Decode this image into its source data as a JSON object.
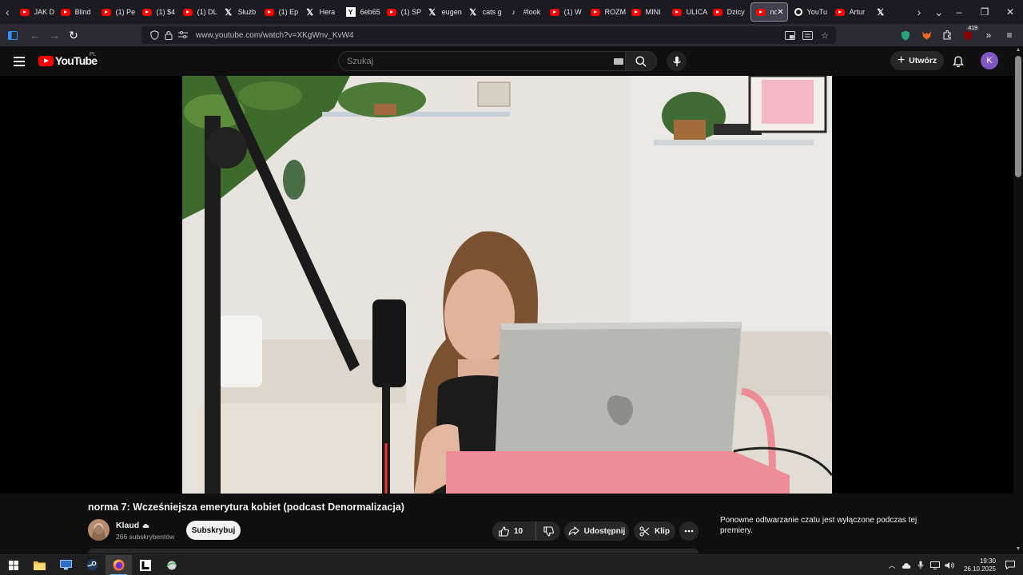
{
  "browser": {
    "tabs": [
      {
        "label": "JAK D",
        "favicon": "youtube-icon"
      },
      {
        "label": "Blind",
        "favicon": "youtube-icon"
      },
      {
        "label": "(1) Pe",
        "favicon": "youtube-icon"
      },
      {
        "label": "(1) $4",
        "favicon": "youtube-icon"
      },
      {
        "label": "(1) DL",
        "favicon": "youtube-icon"
      },
      {
        "label": "Służb",
        "favicon": "x-icon"
      },
      {
        "label": "(1) Ep",
        "favicon": "youtube-icon"
      },
      {
        "label": "Hera",
        "favicon": "x-icon"
      },
      {
        "label": "6eb65",
        "favicon": "ycombinator-icon"
      },
      {
        "label": "(1) SP",
        "favicon": "youtube-icon"
      },
      {
        "label": "eugen",
        "favicon": "x-icon"
      },
      {
        "label": "cats g",
        "favicon": "x-icon"
      },
      {
        "label": "#look",
        "favicon": "tiktok-icon"
      },
      {
        "label": "(1) W",
        "favicon": "youtube-icon"
      },
      {
        "label": "ROZM",
        "favicon": "youtube-icon"
      },
      {
        "label": "MINI",
        "favicon": "youtube-icon"
      },
      {
        "label": "ULICA",
        "favicon": "youtube-icon"
      },
      {
        "label": "Dzicy",
        "favicon": "youtube-icon"
      },
      {
        "label": "no",
        "favicon": "youtube-icon",
        "active": true
      },
      {
        "label": "YouTu",
        "favicon": "camera-icon"
      },
      {
        "label": "Artur",
        "favicon": "youtube-icon"
      },
      {
        "label": "",
        "favicon": "x-icon"
      }
    ],
    "url": "www.youtube.com/watch?v=XKgWnv_KvW4",
    "extension_badge": "419"
  },
  "youtube": {
    "logo_text": "YouTube",
    "country_code": "PL",
    "search_placeholder": "Szukaj",
    "create_label": "Utwórz",
    "avatar_letter": "K"
  },
  "video": {
    "title": "norma 7: Wcześniejsza emerytura kobiet (podcast Denormalizacja)",
    "channel_name": "Klaud",
    "subscribers": "266 subskrybentów",
    "subscribe_label": "Subskrybuj",
    "like_count": "10",
    "share_label": "Udostępnij",
    "clip_label": "Klip",
    "chat_notice": "Ponowne odtwarzanie czatu jest wyłączone podczas tej premiery."
  },
  "taskbar": {
    "time": "19:30",
    "date": "26.10.2025"
  },
  "colors": {
    "youtube_red": "#ff0000",
    "page_background": "#0f0f0f",
    "pill_background": "#272727",
    "avatar_purple": "#7e57c2"
  }
}
